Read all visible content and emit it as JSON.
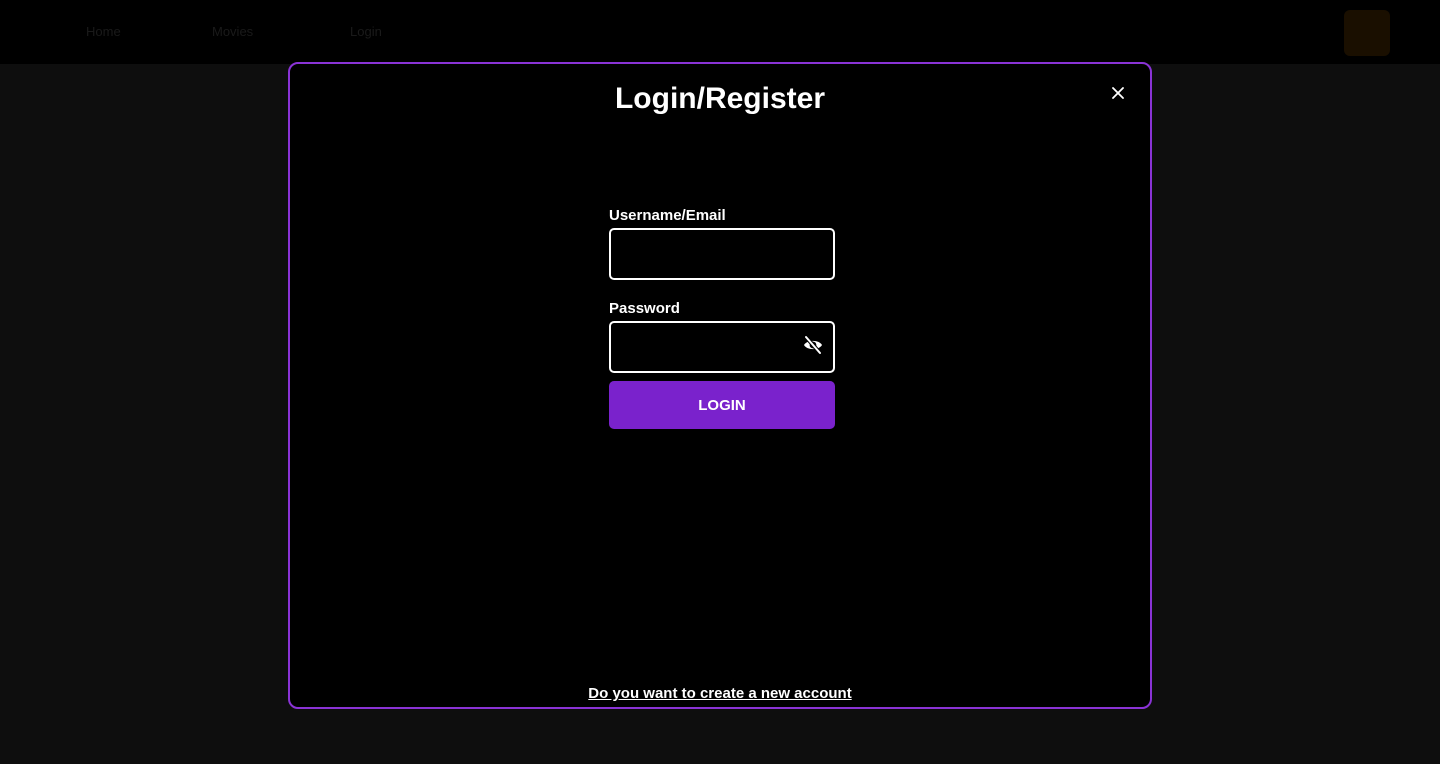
{
  "nav": {
    "items": [
      "Home",
      "Movies",
      "Login"
    ]
  },
  "modal": {
    "title": "Login/Register",
    "close_icon": "close-icon",
    "username_label": "Username/Email",
    "username_value": "",
    "password_label": "Password",
    "password_value": "",
    "toggle_icon": "eye-slash-icon",
    "login_label": "LOGIN",
    "register_link": "Do you want to create a new account"
  },
  "colors": {
    "accent": "#7a22cc",
    "modal_border": "#8a33d6",
    "background": "#0e0e0e"
  }
}
